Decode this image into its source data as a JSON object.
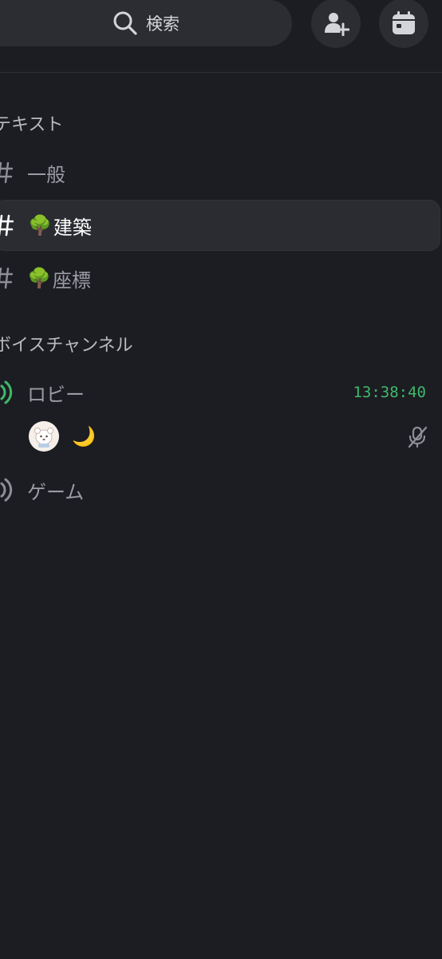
{
  "header": {
    "search_label": "検索",
    "search_icon": "search-icon",
    "add_member_icon": "add-member-icon",
    "events_icon": "calendar-icon"
  },
  "sections": {
    "text_header": "テキスト",
    "voice_header": "ボイスチャンネル"
  },
  "text_channels": [
    {
      "name": "一般",
      "emoji": "",
      "selected": false
    },
    {
      "name": "建築",
      "emoji": "🌳",
      "selected": true
    },
    {
      "name": "座標",
      "emoji": "🌳",
      "selected": false
    }
  ],
  "voice_channels": [
    {
      "name": "ロビー",
      "active": true,
      "elapsed": "13:38:40"
    },
    {
      "name": "ゲーム",
      "active": false
    }
  ],
  "voice_user": {
    "status_emoji": "🌙",
    "muted": true
  },
  "colors": {
    "background": "#1c1d22",
    "active_voice": "#3fb96a",
    "selected_row": "#2a2c31"
  }
}
